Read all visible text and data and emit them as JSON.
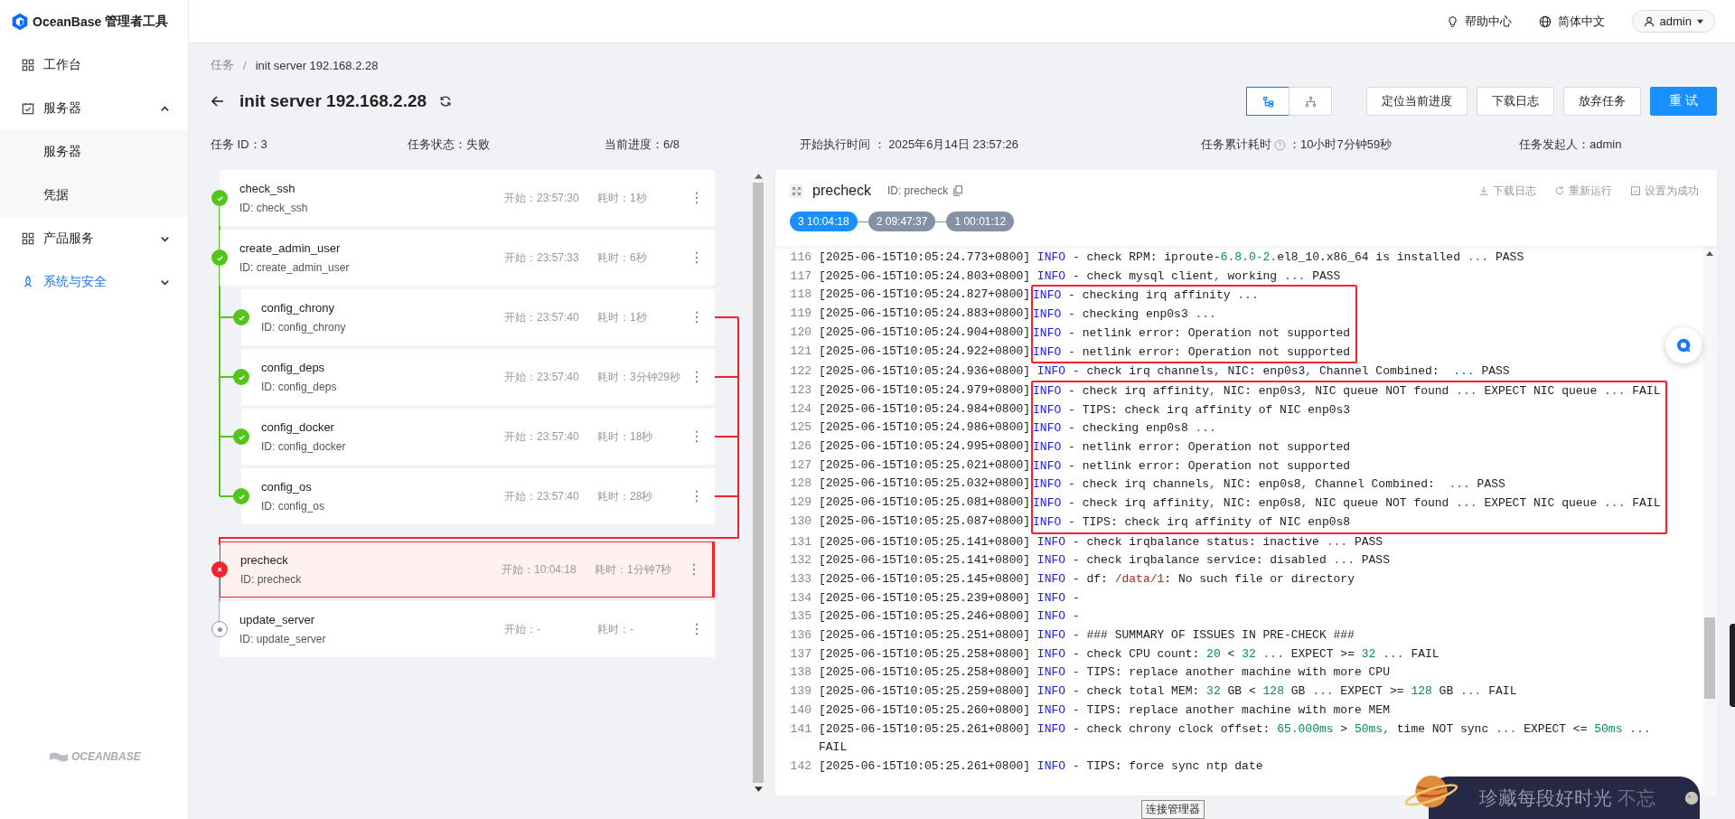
{
  "app": {
    "logo_name": "OceanBase",
    "logo_suffix": "管理者工具",
    "footer_logo": "OCEANBASE"
  },
  "sidebar": {
    "items": [
      {
        "label": "工作台",
        "kind": "link",
        "selected": false
      },
      {
        "label": "服务器",
        "kind": "group",
        "expanded": true,
        "selected": false,
        "children": [
          {
            "label": "服务器",
            "selected": false
          },
          {
            "label": "凭据",
            "selected": false
          }
        ]
      },
      {
        "label": "产品服务",
        "kind": "group",
        "expanded": false,
        "selected": false
      },
      {
        "label": "系统与安全",
        "kind": "group",
        "expanded": false,
        "selected": true
      }
    ]
  },
  "topbar": {
    "help": "帮助中心",
    "language": "简体中文",
    "user": "admin"
  },
  "breadcrumb": {
    "items": [
      "任务",
      "init server 192.168.2.28"
    ],
    "separator": "/"
  },
  "title": "init server 192.168.2.28",
  "view_toggle": [
    {
      "selected": true
    },
    {
      "selected": false
    }
  ],
  "actions": [
    {
      "label": "定位当前进度",
      "kind": "default"
    },
    {
      "label": "下载日志",
      "kind": "default"
    },
    {
      "label": "放弃任务",
      "kind": "default"
    },
    {
      "label": "重 试",
      "kind": "primary"
    }
  ],
  "info": [
    {
      "label": "任务 ID：",
      "value": "3"
    },
    {
      "label": "任务状态：",
      "value": "失败"
    },
    {
      "label": "当前进度：",
      "value": "6/8"
    },
    {
      "label": "开始执行时间 ： ",
      "value": "2025年6月14日 23:57:26"
    },
    {
      "label": "任务累计耗时",
      "help": true,
      "value": "：10小时7分钟59秒"
    },
    {
      "label": "任务发起人：",
      "value": "admin"
    }
  ],
  "tasks": [
    {
      "name": "check_ssh",
      "id": "ID: check_ssh",
      "start": "开始：23:57:30",
      "duration": "耗时：1秒",
      "kind": "success",
      "selected": false
    },
    {
      "name": "create_admin_user",
      "id": "ID: create_admin_user",
      "start": "开始：23:57:33",
      "duration": "耗时：6秒",
      "kind": "success",
      "selected": false,
      "children": [
        {
          "name": "config_chrony",
          "id": "ID: config_chrony",
          "start": "开始：23:57:40",
          "duration": "耗时：1秒",
          "kind": "success",
          "selected": false
        },
        {
          "name": "config_deps",
          "id": "ID: config_deps",
          "start": "开始：23:57:40",
          "duration": "耗时：3分钟29秒",
          "kind": "success",
          "selected": false
        },
        {
          "name": "config_docker",
          "id": "ID: config_docker",
          "start": "开始：23:57:40",
          "duration": "耗时：18秒",
          "kind": "success",
          "selected": false
        },
        {
          "name": "config_os",
          "id": "ID: config_os",
          "start": "开始：23:57:40",
          "duration": "耗时：28秒",
          "kind": "success",
          "selected": false
        }
      ]
    },
    {
      "name": "precheck",
      "id": "ID: precheck",
      "start": "开始：10:04:18",
      "duration": "耗时：1分钟7秒",
      "kind": "failed",
      "selected": true
    },
    {
      "name": "update_server",
      "id": "ID: update_server",
      "start": "开始：-",
      "duration": "耗时：-",
      "kind": "pending",
      "selected": false
    }
  ],
  "log": {
    "title": "precheck",
    "id": "ID: precheck",
    "actions": [
      "下载日志",
      "重新运行",
      "设置为成功"
    ],
    "attempts": [
      {
        "label": "3 10:04:18",
        "selected": true
      },
      {
        "label": "2 09:47:37",
        "selected": false
      },
      {
        "label": "1 00:01:12",
        "selected": false
      }
    ],
    "blocks": [
      {
        "highlighted": false,
        "lines": [
          {
            "no": "116",
            "time": "[2025-06-15T10:05:24.773+0800]",
            "level": "INFO",
            "msg": [
              "- check RPM: iproute-",
              {
                "kind": "number",
                "t": "6.8.0-2."
              },
              "el8_10.x86_64 is installed ",
              {
                "kind": "punct",
                "t": "..."
              },
              " PASS"
            ]
          },
          {
            "no": "117",
            "time": "[2025-06-15T10:05:24.803+0800]",
            "level": "INFO",
            "msg": [
              "- check mysql client",
              {
                "kind": "punct",
                "t": ","
              },
              " working ",
              {
                "kind": "punct",
                "t": "..."
              },
              " PASS"
            ]
          }
        ]
      },
      {
        "highlighted": true,
        "lines": [
          {
            "no": "118",
            "time": "[2025-06-15T10:05:24.827+0800]",
            "level": "INFO",
            "msg": [
              "- checking irq affinity ",
              {
                "kind": "punct",
                "t": "..."
              }
            ]
          },
          {
            "no": "119",
            "time": "[2025-06-15T10:05:24.883+0800]",
            "level": "INFO",
            "msg": [
              "- checking enp0s3 ",
              {
                "kind": "punct",
                "t": "..."
              }
            ]
          },
          {
            "no": "120",
            "time": "[2025-06-15T10:05:24.904+0800]",
            "level": "INFO",
            "msg": [
              "- netlink error: Operation not supported"
            ]
          },
          {
            "no": "121",
            "time": "[2025-06-15T10:05:24.922+0800]",
            "level": "INFO",
            "msg": [
              "- netlink error: Operation not supported"
            ]
          }
        ]
      },
      {
        "highlighted": false,
        "lines": [
          {
            "no": "122",
            "time": "[2025-06-15T10:05:24.936+0800]",
            "level": "INFO",
            "msg": [
              "- check irq channels",
              {
                "kind": "punct",
                "t": ","
              },
              " NIC: enp0s3",
              {
                "kind": "punct",
                "t": ","
              },
              " Channel Combined:  ",
              {
                "kind": "punct",
                "t": "..."
              },
              " PASS"
            ]
          }
        ]
      },
      {
        "highlighted": true,
        "lines": [
          {
            "no": "123",
            "time": "[2025-06-15T10:05:24.979+0800]",
            "level": "INFO",
            "msg": [
              "- check irq affinity",
              {
                "kind": "punct",
                "t": ","
              },
              " NIC: enp0s3",
              {
                "kind": "punct",
                "t": ","
              },
              " NIC queue NOT found ",
              {
                "kind": "punct",
                "t": "..."
              },
              " EXPECT NIC queue ",
              {
                "kind": "punct",
                "t": "..."
              },
              " FAIL"
            ]
          },
          {
            "no": "124",
            "time": "[2025-06-15T10:05:24.984+0800]",
            "level": "INFO",
            "msg": [
              "- TIPS: check irq affinity of NIC enp0s3"
            ]
          },
          {
            "no": "125",
            "time": "[2025-06-15T10:05:24.986+0800]",
            "level": "INFO",
            "msg": [
              "- checking enp0s8 ",
              {
                "kind": "punct",
                "t": "..."
              }
            ]
          },
          {
            "no": "126",
            "time": "[2025-06-15T10:05:24.995+0800]",
            "level": "INFO",
            "msg": [
              "- netlink error: Operation not supported"
            ]
          },
          {
            "no": "127",
            "time": "[2025-06-15T10:05:25.021+0800]",
            "level": "INFO",
            "msg": [
              "- netlink error: Operation not supported"
            ]
          },
          {
            "no": "128",
            "time": "[2025-06-15T10:05:25.032+0800]",
            "level": "INFO",
            "msg": [
              "- check irq channels",
              {
                "kind": "punct",
                "t": ","
              },
              " NIC: enp0s8",
              {
                "kind": "punct",
                "t": ","
              },
              " Channel Combined:  ",
              {
                "kind": "punct",
                "t": "..."
              },
              " PASS"
            ]
          },
          {
            "no": "129",
            "time": "[2025-06-15T10:05:25.081+0800]",
            "level": "INFO",
            "msg": [
              "- check irq affinity",
              {
                "kind": "punct",
                "t": ","
              },
              " NIC: enp0s8",
              {
                "kind": "punct",
                "t": ","
              },
              " NIC queue NOT found ",
              {
                "kind": "punct",
                "t": "..."
              },
              " EXPECT NIC queue ",
              {
                "kind": "punct",
                "t": "..."
              },
              " FAIL"
            ]
          },
          {
            "no": "130",
            "time": "[2025-06-15T10:05:25.087+0800]",
            "level": "INFO",
            "msg": [
              "- TIPS: check irq affinity of NIC enp0s8"
            ]
          }
        ]
      },
      {
        "highlighted": false,
        "lines": [
          {
            "no": "131",
            "time": "[2025-06-15T10:05:25.141+0800]",
            "level": "INFO",
            "msg": [
              "- check irqbalance status: inactive ",
              {
                "kind": "punct",
                "t": "..."
              },
              " PASS"
            ]
          },
          {
            "no": "132",
            "time": "[2025-06-15T10:05:25.141+0800]",
            "level": "INFO",
            "msg": [
              "- check irqbalance service: disabled ",
              {
                "kind": "punct",
                "t": "..."
              },
              " PASS"
            ]
          },
          {
            "no": "133",
            "time": "[2025-06-15T10:05:25.145+0800]",
            "level": "INFO",
            "msg": [
              "- df: ",
              {
                "kind": "path",
                "t": "/data/1"
              },
              ": No such file or directory"
            ]
          },
          {
            "no": "134",
            "time": "[2025-06-15T10:05:25.239+0800]",
            "level": "INFO",
            "msg": [
              "-"
            ]
          },
          {
            "no": "135",
            "time": "[2025-06-15T10:05:25.246+0800]",
            "level": "INFO",
            "msg": [
              "-"
            ]
          },
          {
            "no": "136",
            "time": "[2025-06-15T10:05:25.251+0800]",
            "level": "INFO",
            "msg": [
              "- ### SUMMARY OF ISSUES IN PRE-CHECK ###"
            ]
          },
          {
            "no": "137",
            "time": "[2025-06-15T10:05:25.258+0800]",
            "level": "INFO",
            "msg": [
              "- check CPU count: ",
              {
                "kind": "number",
                "t": "20"
              },
              " < ",
              {
                "kind": "number",
                "t": "32"
              },
              {
                "kind": "punct",
                "t": " ..."
              },
              " EXPECT >= ",
              {
                "kind": "number",
                "t": "32"
              },
              {
                "kind": "punct",
                "t": " ..."
              },
              " FAIL"
            ]
          },
          {
            "no": "138",
            "time": "[2025-06-15T10:05:25.258+0800]",
            "level": "INFO",
            "msg": [
              "- TIPS: replace another machine with more CPU"
            ]
          },
          {
            "no": "139",
            "time": "[2025-06-15T10:05:25.259+0800]",
            "level": "INFO",
            "msg": [
              "- check total MEM: ",
              {
                "kind": "number",
                "t": "32"
              },
              " GB < ",
              {
                "kind": "number",
                "t": "128"
              },
              " GB ",
              {
                "kind": "punct",
                "t": "..."
              },
              " EXPECT >= ",
              {
                "kind": "number",
                "t": "128"
              },
              " GB ",
              {
                "kind": "punct",
                "t": "..."
              },
              " FAIL"
            ]
          },
          {
            "no": "140",
            "time": "[2025-06-15T10:05:25.260+0800]",
            "level": "INFO",
            "msg": [
              "- TIPS: replace another machine with more MEM"
            ]
          },
          {
            "no": "141",
            "time": "[2025-06-15T10:05:25.261+0800]",
            "level": "INFO",
            "msg": [
              "- check chrony clock offset: ",
              {
                "kind": "number",
                "t": "65.000ms"
              },
              " > ",
              {
                "kind": "number",
                "t": "50ms"
              },
              {
                "kind": "punct",
                "t": ","
              },
              " time NOT sync ",
              {
                "kind": "punct",
                "t": "..."
              },
              " EXPECT <= ",
              {
                "kind": "number",
                "t": "50ms"
              },
              {
                "kind": "punct",
                "t": " ..."
              },
              " FAIL"
            ]
          },
          {
            "no": "142",
            "time": "[2025-06-15T10:05:25.261+0800]",
            "level": "INFO",
            "msg": [
              "- TIPS: force sync ntp date"
            ]
          }
        ]
      }
    ]
  },
  "overlay": {
    "tooltip": "连接管理器",
    "widget_text": "珍藏每段好时光",
    "widget_faded": "不忘"
  }
}
